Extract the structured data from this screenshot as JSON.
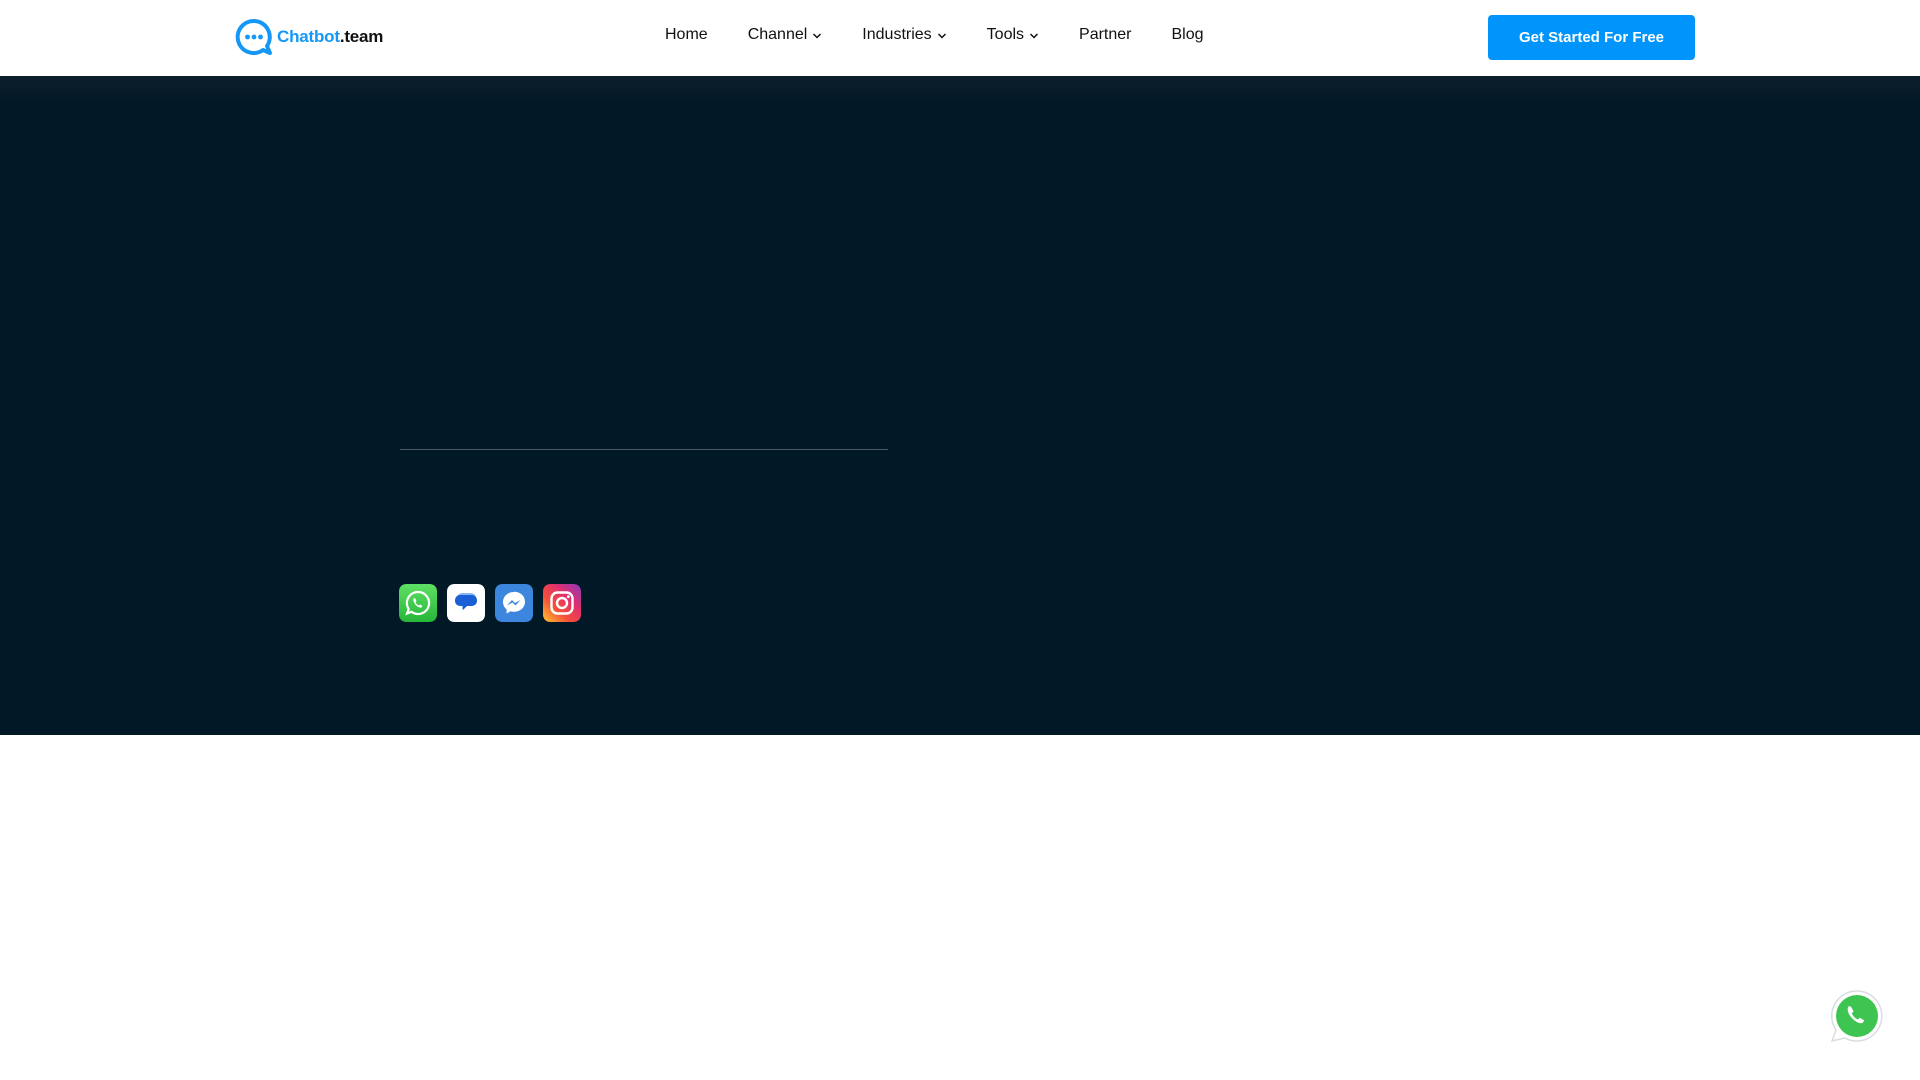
{
  "header": {
    "logo": {
      "brand_main": "Chatbot",
      "brand_suffix": ".team",
      "icon": "chat-bubble-icon"
    },
    "nav": [
      {
        "label": "Home",
        "dropdown": false
      },
      {
        "label": "Channel",
        "dropdown": true
      },
      {
        "label": "Industries",
        "dropdown": true
      },
      {
        "label": "Tools",
        "dropdown": true
      },
      {
        "label": "Partner",
        "dropdown": false
      },
      {
        "label": "Blog",
        "dropdown": false
      }
    ],
    "cta_label": "Get Started For Free"
  },
  "hero": {
    "channels": [
      {
        "name": "WhatsApp",
        "icon": "whatsapp-icon"
      },
      {
        "name": "Messages",
        "icon": "google-messages-icon"
      },
      {
        "name": "Messenger",
        "icon": "messenger-icon"
      },
      {
        "name": "Instagram",
        "icon": "instagram-icon"
      }
    ]
  },
  "floating_button": {
    "icon": "whatsapp-icon"
  },
  "colors": {
    "brand": "#1597f6",
    "cta": "#0195fb",
    "hero_background": "#011826"
  }
}
